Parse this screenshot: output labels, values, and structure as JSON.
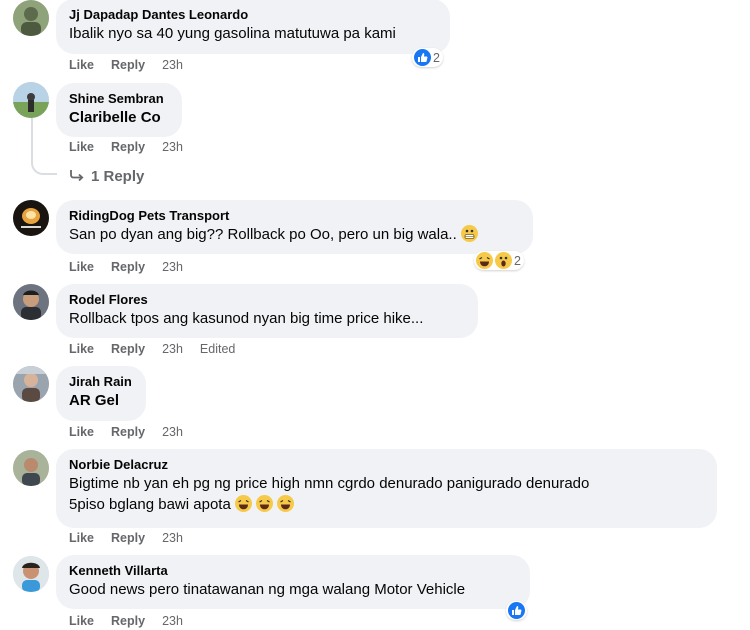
{
  "comments": [
    {
      "name": "Jj Dapadap Dantes Leonardo",
      "text": "Ibalik nyo sa 40 yung gasolina matutuwa pa kami",
      "like": "Like",
      "reply": "Reply",
      "time": "23h",
      "reaction_count": "2"
    },
    {
      "name": "Shine Sembran",
      "text": "Claribelle Co",
      "like": "Like",
      "reply": "Reply",
      "time": "23h",
      "replies_label": "1 Reply"
    },
    {
      "name": "RidingDog Pets Transport",
      "text": "San po dyan ang big?? Rollback po Oo, pero un big wala..",
      "like": "Like",
      "reply": "Reply",
      "time": "23h",
      "reaction_count": "2"
    },
    {
      "name": "Rodel Flores",
      "text": "Rollback tpos ang kasunod nyan big time price hike...",
      "like": "Like",
      "reply": "Reply",
      "time": "23h",
      "edited": "Edited"
    },
    {
      "name": "Jirah Rain",
      "text": "AR Gel",
      "like": "Like",
      "reply": "Reply",
      "time": "23h"
    },
    {
      "name": "Norbie Delacruz",
      "text": "Bigtime nb yan eh pg ng price high nmn cgrdo denurado panigurado denurado",
      "text2": "5piso bglang bawi apota",
      "like": "Like",
      "reply": "Reply",
      "time": "23h"
    },
    {
      "name": "Kenneth Villarta",
      "text": "Good news pero tinatawanan ng mga walang Motor Vehicle",
      "like": "Like",
      "reply": "Reply",
      "time": "23h"
    }
  ],
  "icons": {
    "like_reaction": "like-reaction-icon",
    "haha_reaction": "haha-emoji-icon",
    "wow_reaction": "wow-emoji-icon",
    "grimace_emoji": "grimace-emoji-icon",
    "reply_arrow": "reply-arrow-icon"
  },
  "colors": {
    "bubble": "#f0f2f5",
    "meta": "#65676b",
    "like_blue": "#1877f2",
    "emoji_yellow": "#f7c948"
  }
}
